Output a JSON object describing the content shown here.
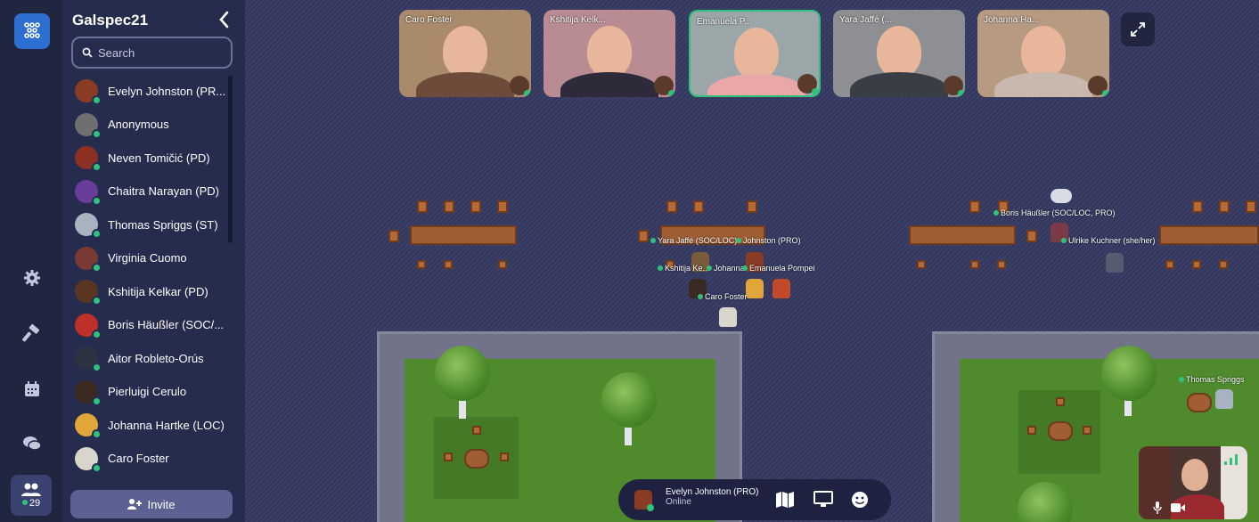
{
  "space_name": "Galspec21",
  "search": {
    "placeholder": "Search"
  },
  "invite_label": "Invite",
  "online_count": "29",
  "people": [
    {
      "name": "Evelyn Johnston (PR...",
      "color": "#8a3b23"
    },
    {
      "name": "Anonymous",
      "color": "#6f6f72"
    },
    {
      "name": "Neven Tomičić (PD)",
      "color": "#8e2f24"
    },
    {
      "name": "Chaitra Narayan (PD)",
      "color": "#6a3d9a"
    },
    {
      "name": "Thomas Spriggs (ST)",
      "color": "#a7b3c0"
    },
    {
      "name": "Virginia Cuomo",
      "color": "#7a3a34"
    },
    {
      "name": "Kshitija Kelkar (PD)",
      "color": "#5a3521"
    },
    {
      "name": "Boris Häußler (SOC/...",
      "color": "#c0302a"
    },
    {
      "name": "Aitor Robleto-Orús",
      "color": "#2e3344"
    },
    {
      "name": "Pierluigi Cerulo",
      "color": "#3b2a22"
    },
    {
      "name": "Johanna Hartke (LOC)",
      "color": "#e0a63a"
    },
    {
      "name": "Caro Foster",
      "color": "#d8d5cc"
    }
  ],
  "video_tiles": [
    {
      "label": "Caro Foster",
      "bg": "#a98a6a",
      "shirt": "#6e4a3a"
    },
    {
      "label": "Kshitija Kelk...",
      "bg": "#b98c94",
      "shirt": "#2e2a3a"
    },
    {
      "label": "Emanuela P...",
      "bg": "#9aa6a8",
      "shirt": "#e9a7a8"
    },
    {
      "label": "Yara Jaffé (...",
      "bg": "#8d8f92",
      "shirt": "#3a3d44"
    },
    {
      "label": "Johanna Ha...",
      "bg": "#b79a82",
      "shirt": "#c8b8ae"
    }
  ],
  "map_labels": {
    "yara": "Yara Jaffé (SOC/LOC)",
    "johnston": "Johnston (PRO)",
    "kshitija": "Kshitija Ke...",
    "johanna": "Johanna",
    "emanuela": "Emanuela Pompei",
    "caro": "Caro Foster",
    "boris": "Boris Häußler (SOC/LOC, PRO)",
    "ulrike": "Ulrike Kuchner (she/her)",
    "thomas": "Thomas Spriggs"
  },
  "bottom_bar": {
    "name": "Evelyn Johnston (PRO)",
    "status": "Online"
  },
  "colors": {
    "accent": "#2d6fd0",
    "online": "#2ec27e",
    "sidebar": "#262c4d",
    "rail": "#202540"
  }
}
